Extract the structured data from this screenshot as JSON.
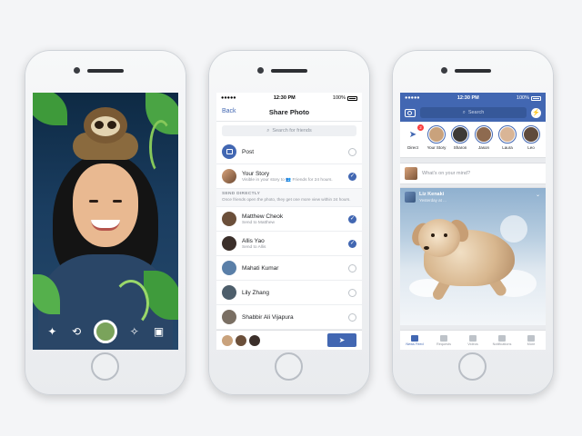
{
  "colors": {
    "facebook_blue": "#4267b2",
    "background": "#f4f5f7"
  },
  "phone1": {
    "controls": [
      "sparkle-wand-icon",
      "flip-camera-icon",
      "shutter-button",
      "effects-icon",
      "gallery-icon"
    ]
  },
  "phone2": {
    "status": {
      "time": "12:30 PM",
      "battery": "100%"
    },
    "header": {
      "back": "Back",
      "title": "Share Photo"
    },
    "search_placeholder": "Search for friends",
    "post": {
      "label": "Post",
      "selected": false
    },
    "story": {
      "label": "Your Story",
      "sub": "Visible in your story to 👥 Friends for 24 hours.",
      "selected": true
    },
    "send_directly": {
      "title": "SEND DIRECTLY",
      "desc": "Once friends open the photo, they get one more view within 24 hours."
    },
    "friends": [
      {
        "name": "Matthew Cheok",
        "sub": "Send to Matthew",
        "selected": true,
        "color": "#6b4f3a"
      },
      {
        "name": "Allis Yao",
        "sub": "Send to Allis",
        "selected": true,
        "color": "#3b2f2a"
      },
      {
        "name": "Mahati Kumar",
        "sub": "",
        "selected": false,
        "color": "#5a7fa8"
      },
      {
        "name": "Lily Zhang",
        "sub": "",
        "selected": false,
        "color": "#4d5e6b"
      },
      {
        "name": "Shabbir Ali Vijapura",
        "sub": "",
        "selected": false,
        "color": "#7a6f63"
      }
    ]
  },
  "phone3": {
    "status": {
      "time": "12:30 PM",
      "battery": "100%"
    },
    "search_label": "Search",
    "stories": [
      {
        "label": "Direct",
        "color": "#ffffff"
      },
      {
        "label": "Your Story",
        "color": "#c9a27c"
      },
      {
        "label": "Sharon",
        "color": "#3d3a36"
      },
      {
        "label": "Jason",
        "color": "#8e6a4f"
      },
      {
        "label": "Laura",
        "color": "#d9b596"
      },
      {
        "label": "Leo",
        "color": "#5f4a3c"
      },
      {
        "label": "Ashi",
        "color": "#a47c5d"
      }
    ],
    "direct_badge": "2",
    "composer_placeholder": "What's on your mind?",
    "post": {
      "author": "Liz Kenaki",
      "time": "Yesterday at ..."
    },
    "tabs": [
      {
        "label": "News Feed",
        "active": true
      },
      {
        "label": "Requests",
        "active": false
      },
      {
        "label": "Videos",
        "active": false
      },
      {
        "label": "Notifications",
        "active": false
      },
      {
        "label": "More",
        "active": false
      }
    ]
  }
}
